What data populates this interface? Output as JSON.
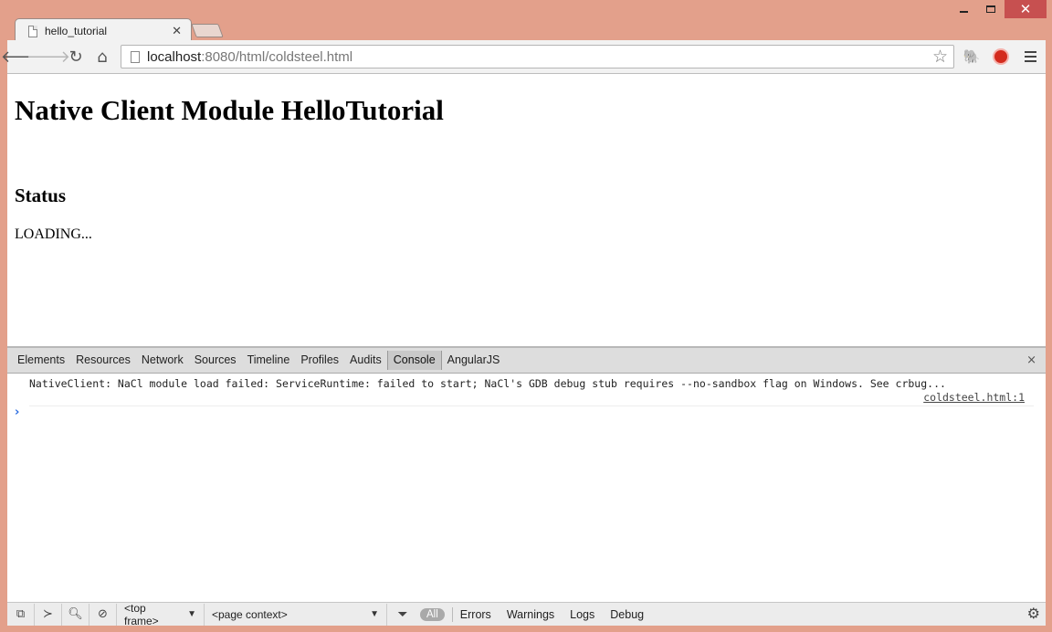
{
  "window": {
    "caption": {
      "minimize": "",
      "maximize": "",
      "close": "✕"
    }
  },
  "tabs": [
    {
      "title": "hello_tutorial",
      "close": "✕"
    }
  ],
  "toolbar": {
    "back_icon": "🡐",
    "forward_icon": "🡒",
    "reload_icon": "↻",
    "home_icon": "⌂",
    "url_host": "localhost",
    "url_rest": ":8080/html/coldsteel.html",
    "star_icon": "☆",
    "evernote_icon": "🐘"
  },
  "page": {
    "heading": "Native Client Module HelloTutorial",
    "status_heading": "Status",
    "status_text": "LOADING..."
  },
  "devtools": {
    "tabs": [
      "Elements",
      "Resources",
      "Network",
      "Sources",
      "Timeline",
      "Profiles",
      "Audits",
      "Console",
      "AngularJS"
    ],
    "active_tab": "Console",
    "close": "×",
    "console": {
      "messages": [
        {
          "text": "NativeClient: NaCl module load failed: ServiceRuntime: failed to start; NaCl's GDB debug stub requires --no-sandbox flag on Windows. See crbug...",
          "source": "coldsteel.html:1"
        }
      ],
      "prompt": "›"
    },
    "statusbar": {
      "frame_select": "<top frame>",
      "context_select": "<page context>",
      "filter_all": "All",
      "levels": [
        "Errors",
        "Warnings",
        "Logs",
        "Debug"
      ]
    }
  },
  "colors": {
    "frame": "#e3a08b",
    "close_button": "#c75050",
    "prompt": "#2b6de0"
  }
}
